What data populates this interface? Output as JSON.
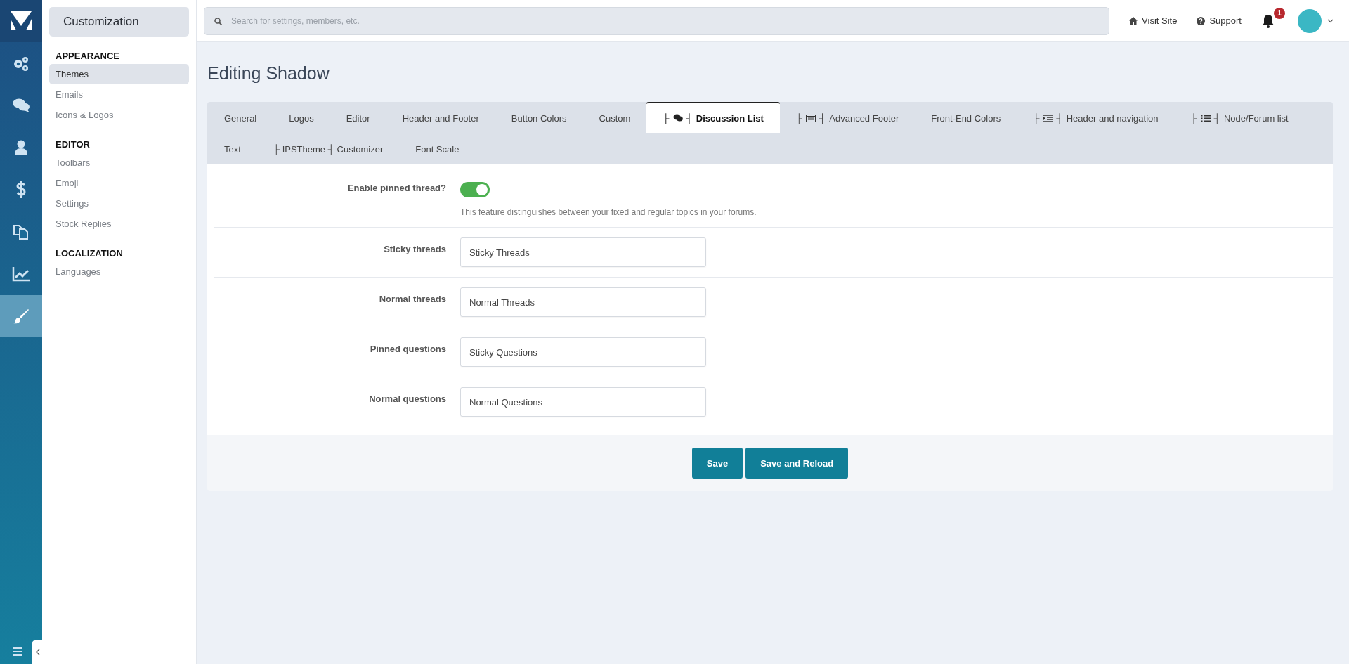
{
  "rail": {
    "items": [
      {
        "kind": "gears",
        "selected": false
      },
      {
        "kind": "chat",
        "selected": false
      },
      {
        "kind": "user",
        "selected": false
      },
      {
        "kind": "dollar",
        "selected": false
      },
      {
        "kind": "copy",
        "selected": false
      },
      {
        "kind": "chart",
        "selected": false
      },
      {
        "kind": "brush",
        "selected": true
      }
    ]
  },
  "sidebar": {
    "title": "Customization",
    "sections": [
      {
        "heading": "APPEARANCE",
        "items": [
          {
            "label": "Themes",
            "selected": true
          },
          {
            "label": "Emails",
            "selected": false
          },
          {
            "label": "Icons & Logos",
            "selected": false
          }
        ]
      },
      {
        "heading": "EDITOR",
        "items": [
          {
            "label": "Toolbars",
            "selected": false
          },
          {
            "label": "Emoji",
            "selected": false
          },
          {
            "label": "Settings",
            "selected": false
          },
          {
            "label": "Stock Replies",
            "selected": false
          }
        ]
      },
      {
        "heading": "LOCALIZATION",
        "items": [
          {
            "label": "Languages",
            "selected": false
          }
        ]
      }
    ]
  },
  "topbar": {
    "search": {
      "placeholder": "Search for settings, members, etc."
    },
    "links": [
      {
        "kind": "home",
        "label": "Visit Site"
      },
      {
        "kind": "question",
        "label": "Support"
      }
    ],
    "notifications": {
      "badge": "1"
    }
  },
  "page": {
    "title": "Editing Shadow"
  },
  "tabs": [
    {
      "kind": "plain",
      "label": "General",
      "selected": false
    },
    {
      "kind": "plain",
      "label": "Logos",
      "selected": false
    },
    {
      "kind": "plain",
      "label": "Editor",
      "selected": false
    },
    {
      "kind": "plain",
      "label": "Header and Footer",
      "selected": false
    },
    {
      "kind": "plain",
      "label": "Button Colors",
      "selected": false
    },
    {
      "kind": "plain",
      "label": "Custom",
      "selected": false
    },
    {
      "kind": "comments",
      "pre": "├",
      "post": "┤",
      "label": "Discussion List",
      "selected": true
    },
    {
      "kind": "card",
      "pre": "├",
      "post": "┤",
      "label": "Advanced Footer",
      "selected": false
    },
    {
      "kind": "plain",
      "label": "Front-End Colors",
      "selected": false
    },
    {
      "kind": "indent",
      "pre": "├",
      "post": "┤",
      "label": "Header and navigation",
      "selected": false
    },
    {
      "kind": "list",
      "pre": "├",
      "post": "┤",
      "label": "Node/Forum list",
      "selected": false
    },
    {
      "kind": "plain",
      "label": "Text",
      "selected": false
    },
    {
      "kind": "plain",
      "label": "├ IPSTheme ┤ Customizer",
      "selected": false
    },
    {
      "kind": "plain",
      "label": "Font Scale",
      "selected": false
    }
  ],
  "form": {
    "rows": [
      {
        "kind": "toggle",
        "label": "Enable pinned thread?",
        "on": true,
        "description": "This feature distinguishes between your fixed and regular topics in your forums."
      },
      {
        "kind": "text",
        "label": "Sticky threads",
        "value": "Sticky Threads"
      },
      {
        "kind": "text",
        "label": "Normal threads",
        "value": "Normal Threads"
      },
      {
        "kind": "text",
        "label": "Pinned questions",
        "value": "Sticky Questions"
      },
      {
        "kind": "text",
        "label": "Normal questions",
        "value": "Normal Questions"
      }
    ],
    "buttons": [
      "Save",
      "Save and Reload"
    ]
  }
}
